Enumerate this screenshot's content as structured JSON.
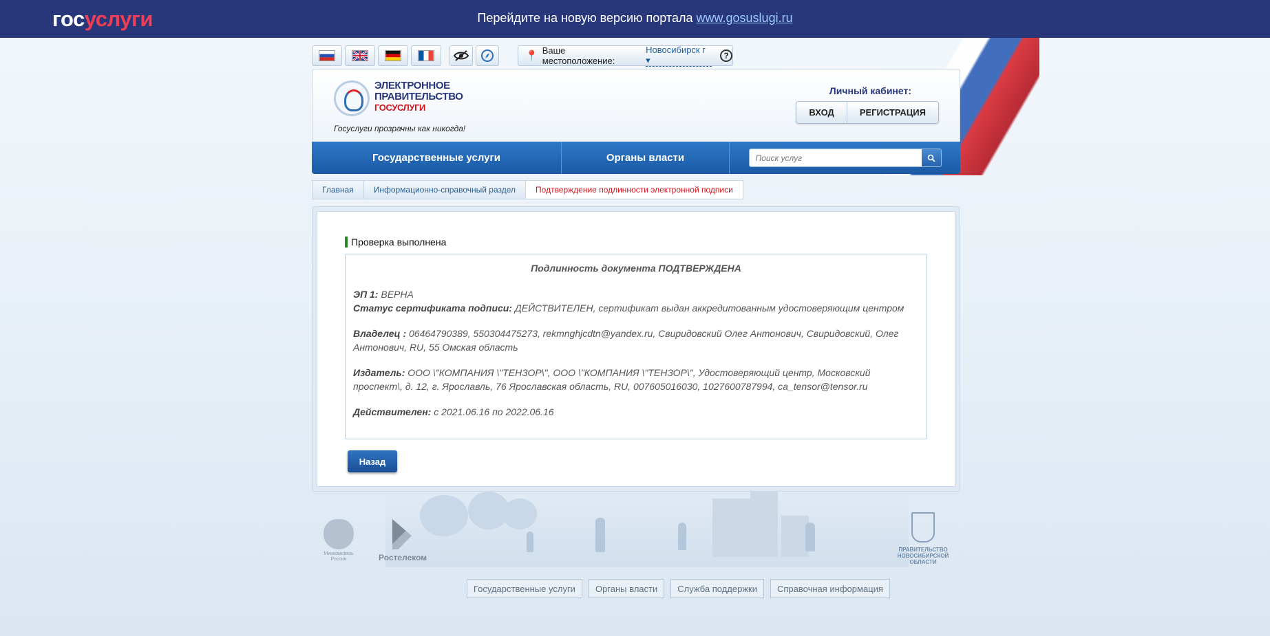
{
  "topbar": {
    "logo_part1": "гос",
    "logo_part2": "услуги",
    "message": "Перейдите на новую версию портала",
    "link": "www.gosuslugi.ru"
  },
  "languages": [
    {
      "code": "ru",
      "icon": "russia-flag-icon"
    },
    {
      "code": "en",
      "icon": "uk-flag-icon"
    },
    {
      "code": "de",
      "icon": "germany-flag-icon"
    },
    {
      "code": "fr",
      "icon": "france-flag-icon"
    }
  ],
  "utilities": {
    "accessibility_icon": "eye-icon",
    "compass_icon": "compass-icon"
  },
  "location": {
    "label": "Ваше местоположение:",
    "city": "Новосибирск г",
    "help": "?"
  },
  "egov": {
    "line1": "ЭЛЕКТРОННОЕ",
    "line2": "ПРАВИТЕЛЬСТВО",
    "line3": "ГОСУСЛУГИ",
    "slogan": "Госуслуги прозрачны как никогда!"
  },
  "cabinet": {
    "label": "Личный кабинет:",
    "login": "ВХОД",
    "register": "РЕГИСТРАЦИЯ"
  },
  "nav": {
    "services": "Государственные услуги",
    "authorities": "Органы власти",
    "search_placeholder": "Поиск услуг"
  },
  "breadcrumb": [
    "Главная",
    "Информационно-справочный раздел",
    "Подтверждение подлинности электронной подписи"
  ],
  "result": {
    "heading": "Проверка выполнена",
    "title": "Подлинность документа ПОДТВЕРЖДЕНА",
    "ep_label": "ЭП 1:",
    "ep_value": "ВЕРНА",
    "status_label": "Статус сертификата подписи:",
    "status_value": "ДЕЙСТВИТЕЛЕН, сертификат выдан аккредитованным удостоверяющим центром",
    "owner_label": "Владелец :",
    "owner_value": "06464790389, 550304475273, rekmnghjcdtn@yandex.ru, Свиридовский Олег Антонович, Свиридовский, Олег Антонович, RU, 55 Омская область",
    "issuer_label": "Издатель:",
    "issuer_value": "ООО \\\"КОМПАНИЯ \\\"ТЕНЗОР\\\", ООО \\\"КОМПАНИЯ \\\"ТЕНЗОР\\\", Удостоверяющий центр, Московский проспект\\, д. 12, г. Ярославль, 76 Ярославская область, RU, 007605016030, 1027600787994, ca_tensor@tensor.ru",
    "valid_label": "Действителен:",
    "valid_value": "с 2021.06.16 по 2022.06.16",
    "back": "Назад"
  },
  "footer": {
    "minsvyaz_line1": "Минкомсвязь",
    "minsvyaz_line2": "России",
    "rostelecom": "Ростелеком",
    "nso_line1": "ПРАВИТЕЛЬСТВО",
    "nso_line2": "НОВОСИБИРСКОЙ",
    "nso_line3": "ОБЛАСТИ",
    "links": [
      "Государственные услуги",
      "Органы власти",
      "Служба поддержки",
      "Справочная информация"
    ]
  }
}
